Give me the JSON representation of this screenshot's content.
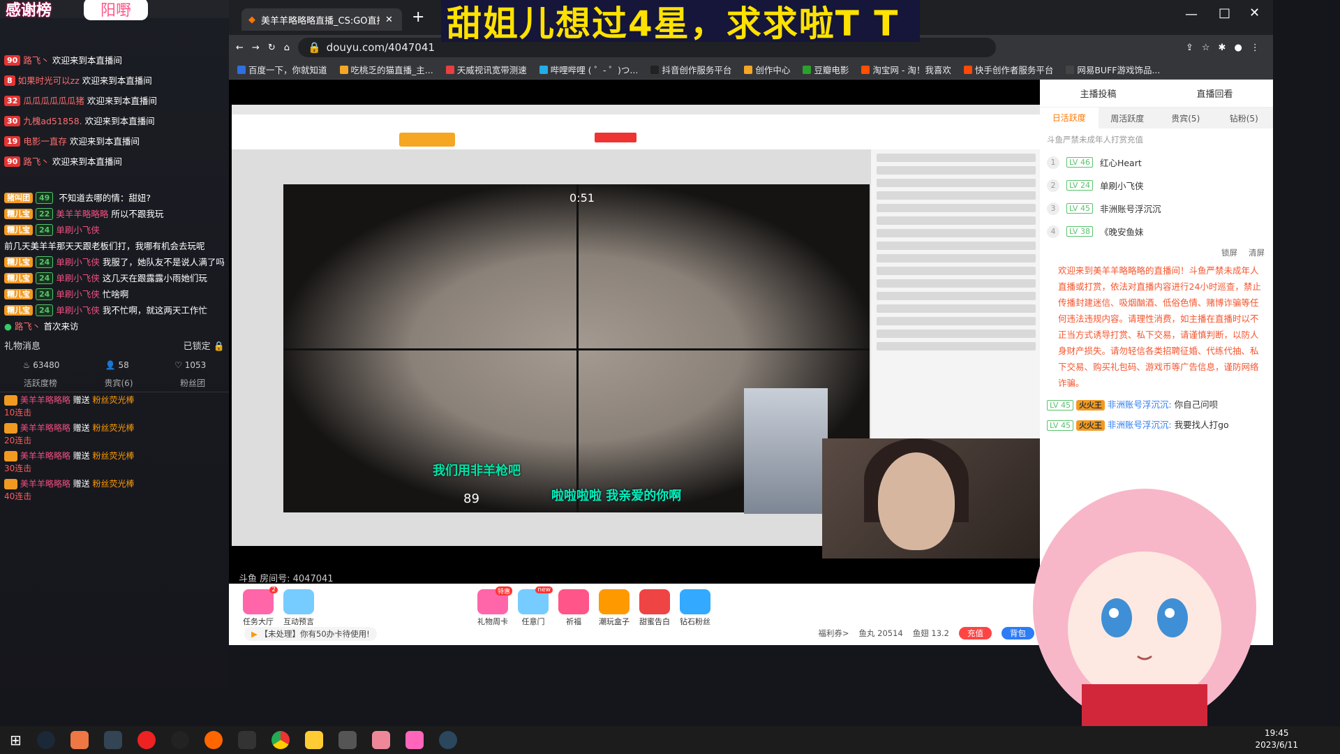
{
  "overlay": {
    "header_title": "感谢榜",
    "header_badge": "阳嘢",
    "chat": [
      {
        "level": "90",
        "user": "路飞丶",
        "msg": "欢迎来到本直播间"
      },
      {
        "level": "8",
        "user": "如果时光可以zz",
        "msg": "欢迎来到本直播间"
      },
      {
        "level": "32",
        "user": "瓜瓜瓜瓜瓜瓜猪",
        "msg": "欢迎来到本直播间"
      },
      {
        "level": "30",
        "user": "九槐ad51858.",
        "msg": "欢迎来到本直播间"
      },
      {
        "level": "19",
        "user": "电影一直存",
        "msg": "欢迎来到本直播间"
      },
      {
        "level": "90",
        "user": "路飞丶",
        "msg": "欢迎来到本直播间"
      }
    ],
    "danmu": [
      {
        "fan": "猪叫团",
        "lv": "49",
        "user": "",
        "msg": "不知道去哪的情：甜妞?"
      },
      {
        "fan": "糯儿宝",
        "lv": "22",
        "user": "美羊羊略略略",
        "msg": "所以不跟我玩"
      },
      {
        "fan": "糯儿宝",
        "lv": "24",
        "user": "单刷小飞侠",
        "msg": "前几天美羊羊那天天跟老板们打，我哪有机会去玩呢"
      },
      {
        "fan": "糯儿宝",
        "lv": "24",
        "user": "单刷小飞侠",
        "msg": "我服了，她队友不是说人满了吗"
      },
      {
        "fan": "糯儿宝",
        "lv": "24",
        "user": "单刷小飞侠",
        "msg": "这几天在跟露露小雨她们玩"
      },
      {
        "fan": "糯儿宝",
        "lv": "24",
        "user": "单刷小飞侠",
        "msg": "忙啥啊"
      },
      {
        "fan": "糯儿宝",
        "lv": "24",
        "user": "单刷小飞侠",
        "msg": "我不忙啊，就这两天工作忙"
      }
    ],
    "first_visit": {
      "user": "路飞丶",
      "msg": "首次来访"
    },
    "gift_section": "礼物消息",
    "locked": "已锁定",
    "stats": {
      "hot": "63480",
      "people": "58",
      "likes": "1053"
    },
    "gift_tabs": [
      "活跃度榜",
      "贵宾(6)",
      "粉丝团"
    ],
    "gifts": [
      {
        "user": "美羊羊略略略",
        "action": "赠送",
        "gift": "粉丝荧光棒",
        "combo": "10连击"
      },
      {
        "user": "美羊羊略略略",
        "action": "赠送",
        "gift": "粉丝荧光棒",
        "combo": "20连击"
      },
      {
        "user": "美羊羊略略略",
        "action": "赠送",
        "gift": "粉丝荧光棒",
        "combo": "30连击"
      },
      {
        "user": "美羊羊略略略",
        "action": "赠送",
        "gift": "粉丝荧光棒",
        "combo": "40连击"
      }
    ]
  },
  "browser": {
    "tab_title": "美羊羊略略略直播_CS:GO直播_",
    "url": "douyu.com/4047041",
    "bookmarks": [
      "百度一下，你就知道",
      "吃桃乏的猫直播_主...",
      "天威视讯宽带测速",
      "哔哩哔哩 ( ゜- ゜)つ...",
      "抖音创作服务平台",
      "创作中心",
      "豆瓣电影",
      "淘宝网 - 淘！我喜欢",
      "快手创作者服务平台",
      "网易BUFF游戏饰品..."
    ],
    "bookmark_colors": [
      "#2f6fe0",
      "#f5a623",
      "#e84040",
      "#23ade5",
      "#222222",
      "#f5a623",
      "#2ca02c",
      "#ff5000",
      "#ff4906",
      "#444444"
    ]
  },
  "banner": "甜姐儿想过4星，求求啦T T",
  "stream": {
    "subtitle1": "我们用非羊枪吧",
    "subtitle2": "啦啦啦啦 我亲爱的你啊",
    "ammo": "89",
    "timer": "0:51"
  },
  "room_id": "斗鱼 房间号: 4047041",
  "right": {
    "top_left": "主播投稿",
    "top_right": "直播回看",
    "tabs": [
      "日活跃度",
      "周活跃度",
      "贵宾(5)",
      "钻粉(5)"
    ],
    "notice_minor": "斗鱼严禁未成年人打赏充值",
    "ranks": [
      {
        "n": "1",
        "lv": "LV 46",
        "name": "红心Heart"
      },
      {
        "n": "2",
        "lv": "LV 24",
        "name": "单刷小飞侠"
      },
      {
        "n": "3",
        "lv": "LV 45",
        "name": "非洲账号浮沉沉"
      },
      {
        "n": "4",
        "lv": "LV 38",
        "name": "《晚安鱼妹"
      }
    ],
    "lock_label": "锁屏",
    "clear_label": "清屏",
    "notice": "欢迎来到美羊羊略略略的直播间！斗鱼严禁未成年人直播或打赏，依法对直播内容进行24小时巡查，禁止传播封建迷信、吸烟酗酒、低俗色情、赌博诈骗等任何违法违规内容。请理性消费，如主播在直播时以不正当方式诱导打赏、私下交易，请谨慎判断，以防人身财产损失。请勿轻信各类招聘征婚、代练代抽、私下交易、购买礼包码、游戏币等广告信息，谨防网络诈骗。",
    "msgs": [
      {
        "lv": "LV 45",
        "fan": "火火王",
        "user": "非洲账号浮沉沉:",
        "msg": "你自己问呗"
      },
      {
        "lv": "LV 45",
        "fan": "火火王",
        "user": "非洲账号浮沉沉:",
        "msg": "我要找人打go"
      }
    ]
  },
  "giftbar": {
    "left": [
      {
        "label": "任务大厅",
        "badge": "2"
      },
      {
        "label": "互动预言",
        "badge": ""
      }
    ],
    "mid": [
      {
        "label": "礼物周卡",
        "badge": "特惠"
      },
      {
        "label": "任意门",
        "badge": "new"
      },
      {
        "label": "祈福",
        "badge": ""
      },
      {
        "label": "潮玩盒子",
        "badge": ""
      },
      {
        "label": "甜蜜告白",
        "badge": ""
      },
      {
        "label": "钻石粉丝",
        "badge": ""
      }
    ],
    "notice": "【未处理】你有50办卡待使用!",
    "welfare": "福利券>",
    "fishball": "鱼丸 20514",
    "fishwing": "鱼翅 13.2",
    "recharge": "充值",
    "bag": "背包"
  },
  "taskbar": {
    "time": "19:45",
    "date": "2023/6/11"
  }
}
